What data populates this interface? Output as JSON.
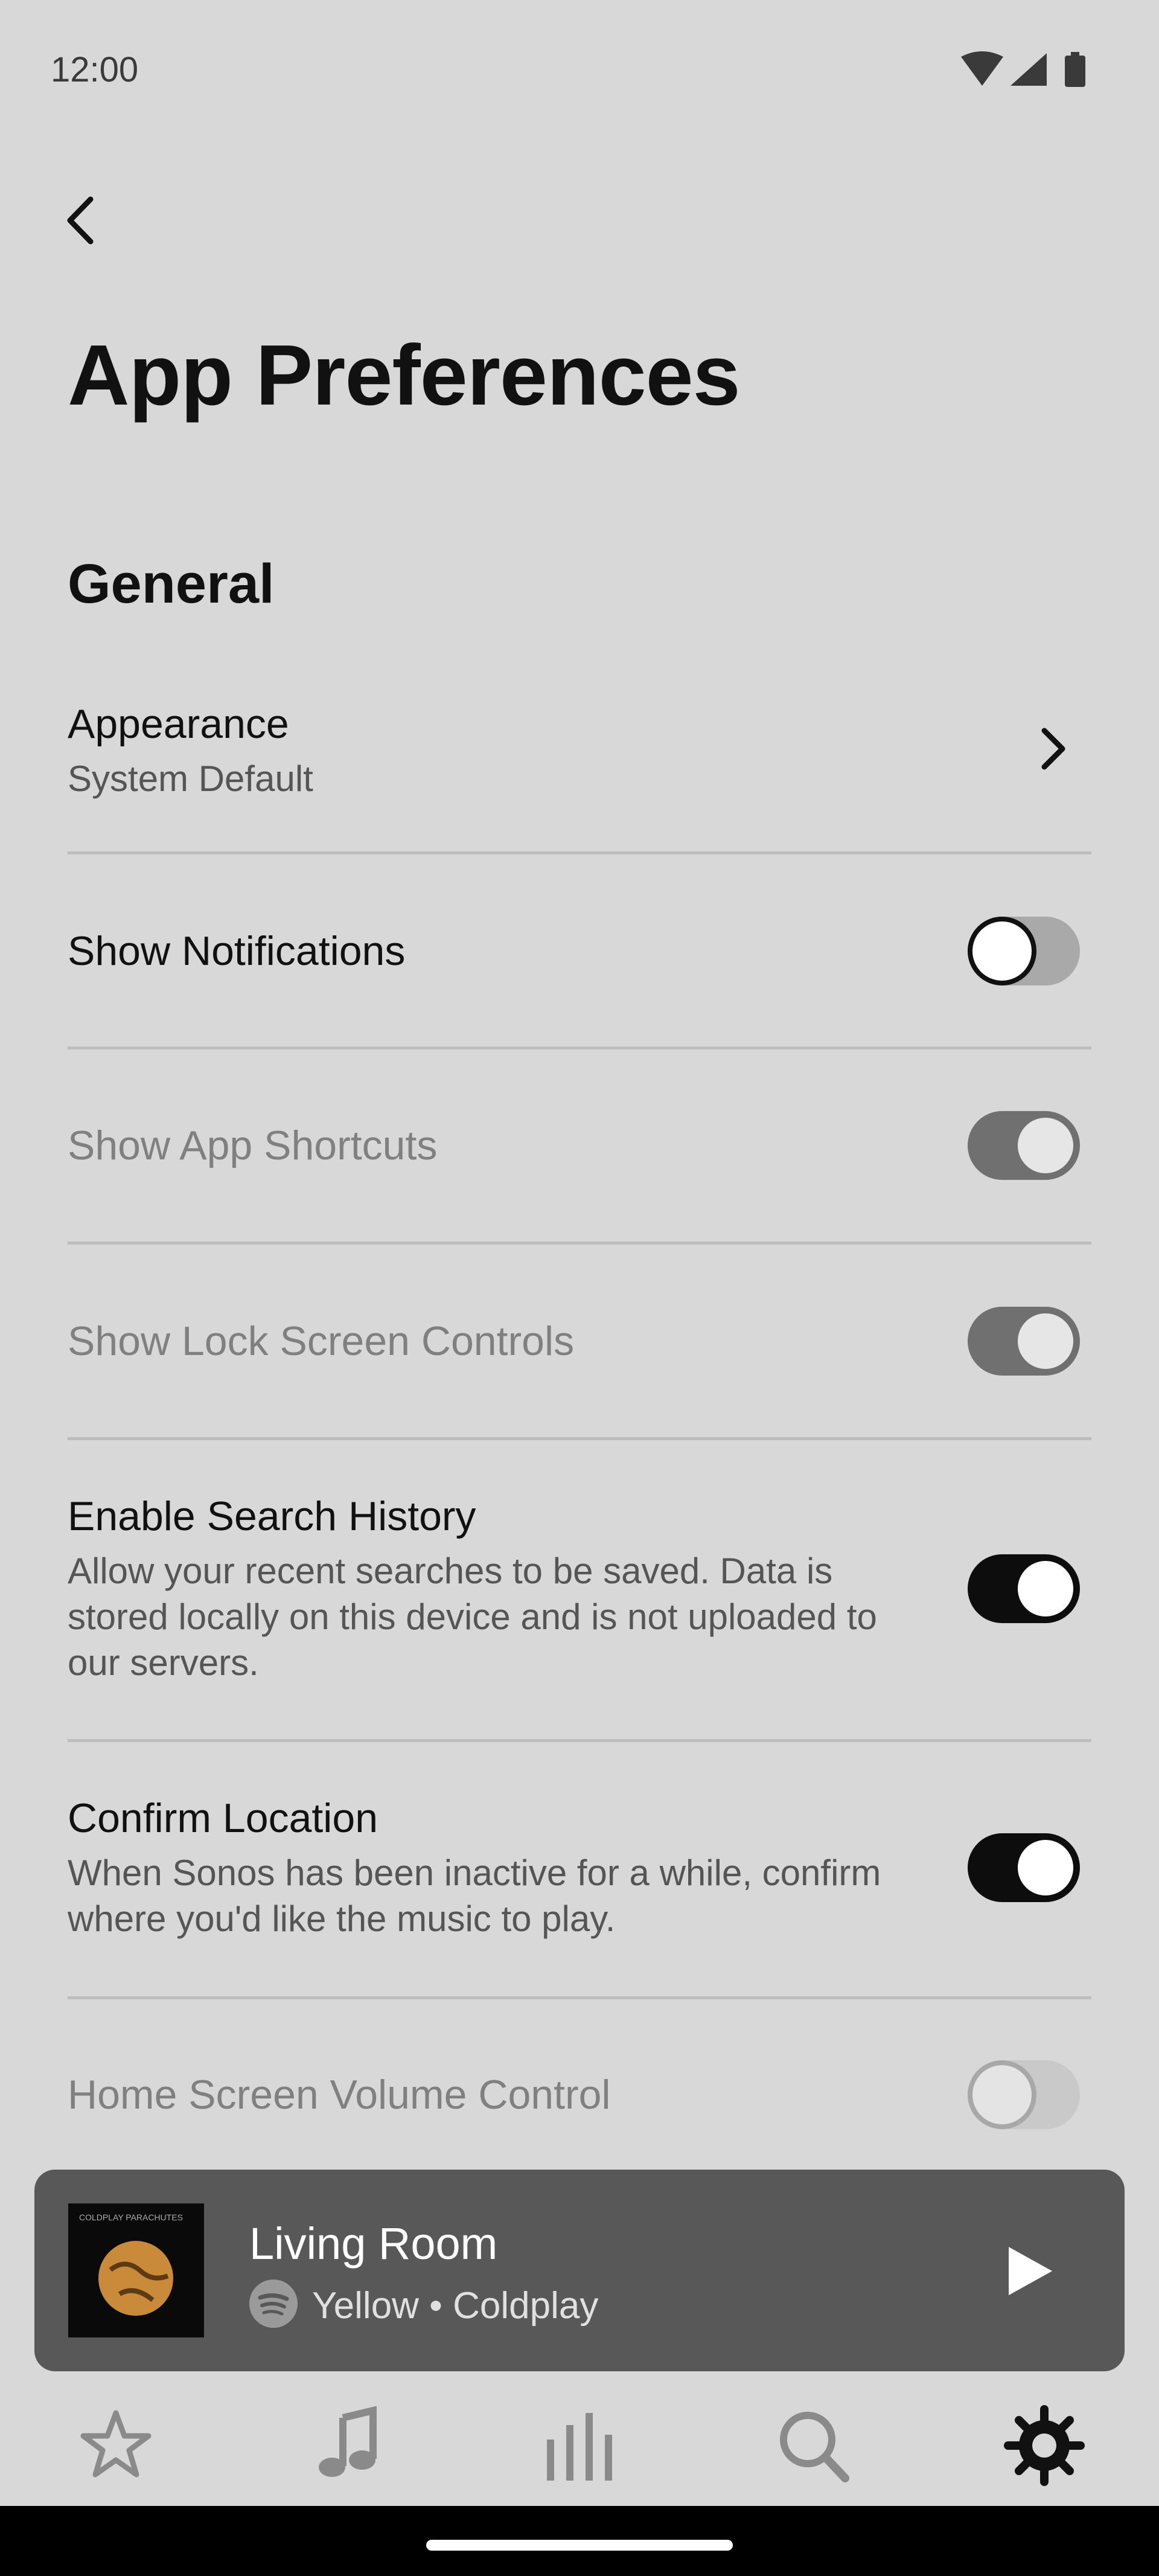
{
  "status_bar": {
    "time": "12:00"
  },
  "header": {
    "title": "App Preferences"
  },
  "section": {
    "title": "General"
  },
  "rows": [
    {
      "title": "Appearance",
      "subtitle": "System Default",
      "control": "chevron"
    },
    {
      "title": "Show Notifications",
      "control": "toggle",
      "state": "off"
    },
    {
      "title": "Show App Shortcuts",
      "control": "toggle",
      "state": "on",
      "disabled": true
    },
    {
      "title": "Show Lock Screen Controls",
      "control": "toggle",
      "state": "on",
      "disabled": true
    },
    {
      "title": "Enable Search History",
      "subtitle": "Allow your recent searches to be saved. Data is stored locally on this device and is not uploaded to our servers.",
      "control": "toggle",
      "state": "on"
    },
    {
      "title": "Confirm Location",
      "subtitle": "When Sonos has been inactive for a while, confirm where you'd like the music to play.",
      "control": "toggle",
      "state": "on"
    },
    {
      "title": "Home Screen Volume Control",
      "control": "toggle",
      "state": "off",
      "disabled": true
    }
  ],
  "player": {
    "room": "Living Room",
    "track": "Yellow • Coldplay",
    "service_icon": "spotify-icon",
    "album_text": "COLDPLAY  PARACHUTES"
  },
  "tabs": [
    {
      "name": "favorites",
      "icon": "star-icon"
    },
    {
      "name": "music",
      "icon": "music-note-icon"
    },
    {
      "name": "rooms",
      "icon": "equalizer-bars-icon"
    },
    {
      "name": "search",
      "icon": "search-icon"
    },
    {
      "name": "settings",
      "icon": "gear-icon",
      "active": true
    }
  ],
  "colors": {
    "background": "#d8d8d8",
    "player": "#585858",
    "toggle_on": "#0d0d0d"
  }
}
